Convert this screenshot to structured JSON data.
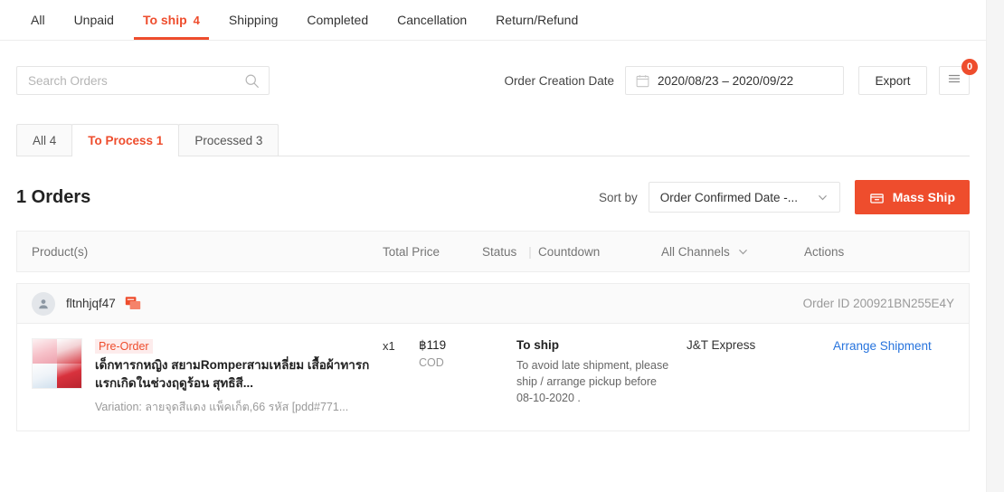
{
  "top_tabs": [
    {
      "label": "All",
      "count": "",
      "active": false
    },
    {
      "label": "Unpaid",
      "count": "",
      "active": false
    },
    {
      "label": "To ship",
      "count": "4",
      "active": true
    },
    {
      "label": "Shipping",
      "count": "",
      "active": false
    },
    {
      "label": "Completed",
      "count": "",
      "active": false
    },
    {
      "label": "Cancellation",
      "count": "",
      "active": false
    },
    {
      "label": "Return/Refund",
      "count": "",
      "active": false
    }
  ],
  "filters": {
    "search_placeholder": "Search Orders",
    "search_value": "",
    "date_label": "Order Creation Date",
    "date_range": "2020/08/23 – 2020/09/22",
    "export_label": "Export",
    "doc_badge": "0"
  },
  "sub_tabs": [
    {
      "label": "All 4",
      "active": false
    },
    {
      "label": "To Process 1",
      "active": true
    },
    {
      "label": "Processed 3",
      "active": false
    }
  ],
  "orders_header": {
    "count_label": "1 Orders",
    "sort_label": "Sort by",
    "sort_value": "Order Confirmed Date -...",
    "mass_ship_label": "Mass Ship"
  },
  "table_header": {
    "product": "Product(s)",
    "total_price": "Total Price",
    "status": "Status",
    "separator": "|",
    "countdown": "Countdown",
    "channel": "All Channels",
    "actions": "Actions"
  },
  "orders": [
    {
      "buyer": "fltnhjqf47",
      "order_id": "Order ID 200921BN255E4Y",
      "pre_order_tag": "Pre-Order",
      "product_title": "เด็กทารกหญิง สยามRomperสามเหลี่ยม เสื้อผ้าทารกแรกเกิดในช่วงฤดูร้อน สุทธิสี...",
      "variation": "Variation: ลายจุดสีแดง แพ็คเก็ต,66 รหัส [pdd#771...",
      "quantity": "x1",
      "price": "฿119",
      "payment": "COD",
      "status_title": "To ship",
      "status_note": "To avoid late shipment, please ship / arrange pickup before 08-10-2020 .",
      "channel": "J&T Express",
      "action": "Arrange Shipment"
    }
  ],
  "colors": {
    "brand": "#ee4d2d",
    "link": "#2673dd",
    "text": "#222222",
    "muted": "#9a9a9a"
  }
}
